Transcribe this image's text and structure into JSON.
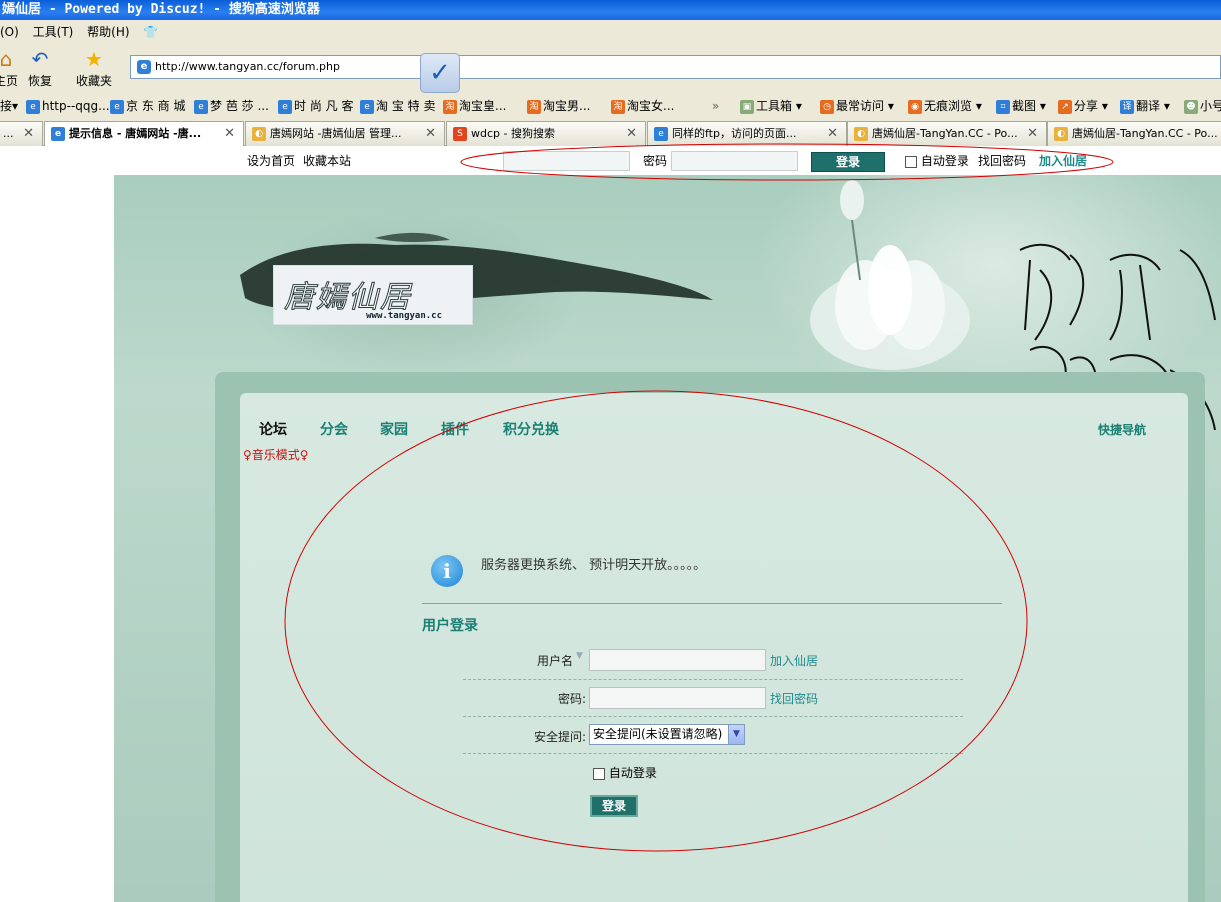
{
  "browser": {
    "title": "嫣仙居 - Powered by Discuz! - 搜狗高速浏览器",
    "menu": [
      "(O)",
      "工具(T)",
      "帮助(H)"
    ],
    "toolbar": {
      "home": "主页",
      "restore": "恢复",
      "favorites": "收藏夹"
    },
    "address": "http://www.tangyan.cc/forum.php",
    "favbar": {
      "left": [
        "接▾",
        "http--qqg...",
        "京 东 商 城",
        "梦 芭 莎 ...",
        "时 尚 凡 客",
        "淘 宝 特 卖",
        "淘宝皇...",
        "淘宝男...",
        "淘宝女..."
      ],
      "right": [
        "工具箱 ▾",
        "最常访问 ▾",
        "无痕浏览 ▾",
        "截图 ▾",
        "分享 ▾",
        "翻译 ▾",
        "小号"
      ]
    },
    "tabs": [
      {
        "label": "..."
      },
      {
        "label": "提示信息 - 唐嫣网站 -唐..."
      },
      {
        "label": "唐嫣网站 -唐嫣仙居 管理..."
      },
      {
        "label": "wdcp - 搜狗搜索"
      },
      {
        "label": "同样的ftp，访问的页面..."
      },
      {
        "label": "唐嫣仙居-TangYan.CC - Po..."
      },
      {
        "label": "唐嫣仙居-TangYan.CC - Po..."
      }
    ]
  },
  "topbar": {
    "set_home": "设为首页",
    "bookmark": "收藏本站",
    "password_label": "密码",
    "login_button": "登录",
    "auto_login": "自动登录",
    "find_password": "找回密码",
    "join": "加入仙居"
  },
  "header": {
    "logo_text": "唐嫣仙居",
    "logo_url": "www.tangyan.cc"
  },
  "nav": {
    "items": [
      "论坛",
      "分会",
      "家园",
      "插件",
      "积分兑换"
    ],
    "music": "♀音乐模式♀",
    "quick_nav": "快捷导航"
  },
  "message": "服务器更换系统、 预计明天开放。。。。。",
  "login_form": {
    "title": "用户登录",
    "username_label": "用户名",
    "username_link": "加入仙居",
    "password_label": "密码:",
    "password_link": "找回密码",
    "question_label": "安全提问:",
    "question_value": "安全提问(未设置请忽略)",
    "auto_login": "自动登录",
    "submit": "登录"
  },
  "colors": {
    "accent": "#1b7f73",
    "button": "#1f6f6a",
    "annotation": "#d00000"
  }
}
